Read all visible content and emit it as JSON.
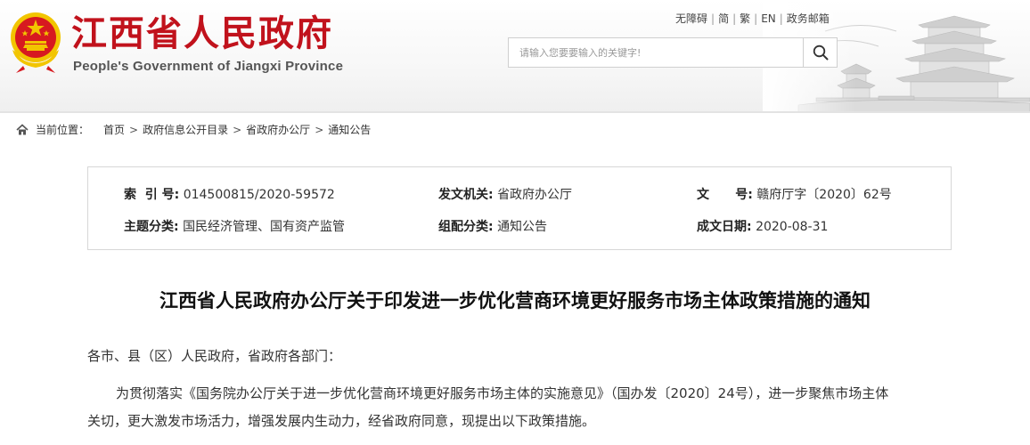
{
  "header": {
    "title": "江西省人民政府",
    "subtitle": "People's Government of Jiangxi Province",
    "links": [
      "无障碍",
      "简",
      "繁",
      "EN",
      "政务邮箱"
    ],
    "search_placeholder": "请输入您要要输入的关键字!"
  },
  "breadcrumb": {
    "label": "当前位置：",
    "items": [
      "首页",
      "政府信息公开目录",
      "省政府办公厅",
      "通知公告"
    ]
  },
  "meta": {
    "index_label": "索  引 号:",
    "index_value": "014500815/2020-59572",
    "issuer_label": "发文机关:",
    "issuer_value": "省政府办公厅",
    "docno_label": "文      号:",
    "docno_value": "赣府厅字〔2020〕62号",
    "topic_label": "主题分类:",
    "topic_value": "国民经济管理、国有资产监管",
    "group_label": "组配分类:",
    "group_value": "通知公告",
    "date_label": "成文日期:",
    "date_value": "2020-08-31"
  },
  "article": {
    "title": "江西省人民政府办公厅关于印发进一步优化营商环境更好服务市场主体政策措施的通知",
    "salutation": "各市、县（区）人民政府，省政府各部门：",
    "body_line1": "为贯彻落实《国务院办公厅关于进一步优化营商环境更好服务市场主体的实施意见》（国办发〔2020〕24号），进一步聚焦市场主体",
    "body_line2": "关切，更大激发市场活力，增强发展内生动力，经省政府同意，现提出以下政策措施。"
  },
  "colors": {
    "brand_red": "#c1121c",
    "emblem_gold": "#f2c500"
  }
}
